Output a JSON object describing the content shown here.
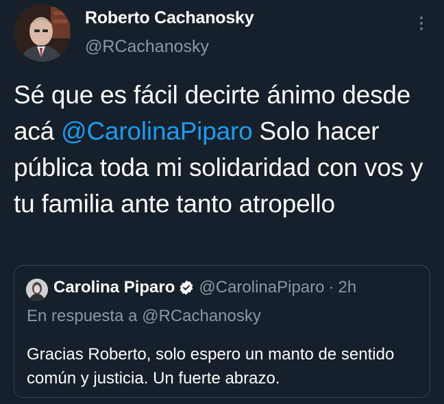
{
  "tweet": {
    "author": {
      "name": "Roberto Cachanosky",
      "handle": "@RCachanosky"
    },
    "text_before": "Sé que es fácil decirte ánimo desde acá ",
    "mention": "@CarolinaPiparo",
    "text_after": " Solo hacer pública toda mi solidaridad con vos y tu familia ante tanto atropello"
  },
  "quoted_tweet": {
    "name": "Carolina Piparo",
    "handle": "@CarolinaPiparo",
    "separator": "·",
    "time": "2h",
    "reply_prefix": "En respuesta a ",
    "reply_to": "@RCachanosky",
    "text": "Gracias Roberto, solo espero un manto de sentido común y justicia. Un fuerte abrazo."
  },
  "icons": {
    "more": "more-vertical-icon",
    "verified": "verified-badge-icon"
  },
  "colors": {
    "background": "#15202b",
    "accent": "#1d9bf0",
    "secondary_text": "#8899a6",
    "border": "#38444d"
  }
}
